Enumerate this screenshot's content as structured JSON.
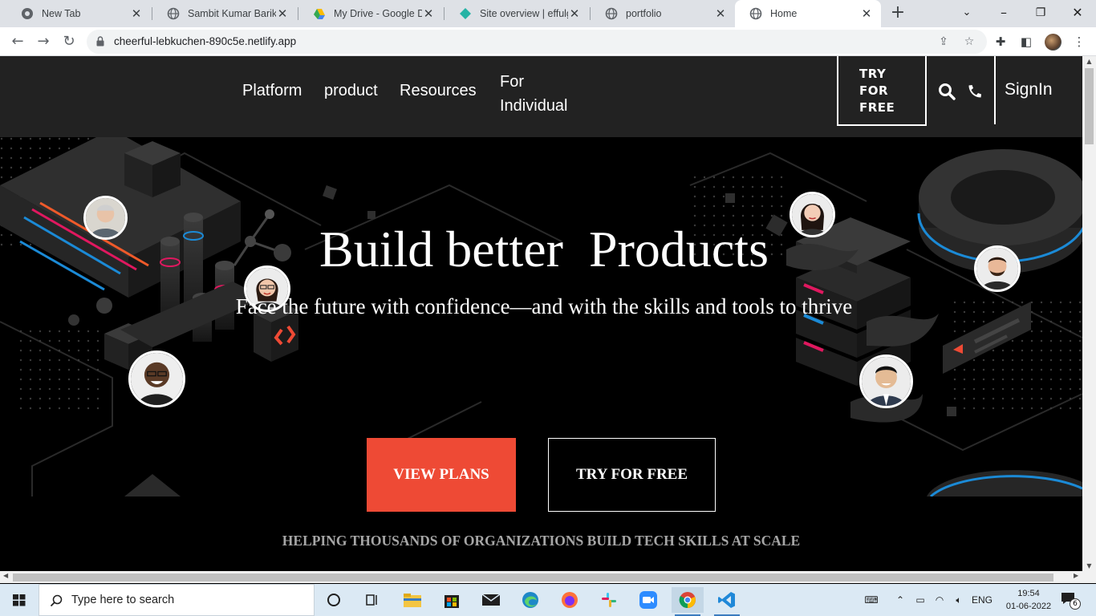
{
  "browser": {
    "tabs": [
      {
        "title": "New Tab",
        "icon": "chrome-icon"
      },
      {
        "title": "Sambit Kumar Barik | F",
        "icon": "globe-icon"
      },
      {
        "title": "My Drive - Google Dri",
        "icon": "google-drive-icon"
      },
      {
        "title": "Site overview | effulge",
        "icon": "netlify-icon"
      },
      {
        "title": "portfolio",
        "icon": "globe-icon"
      },
      {
        "title": "Home",
        "icon": "globe-icon",
        "active": true
      }
    ],
    "url": "cheerful-lebkuchen-890c5e.netlify.app"
  },
  "site": {
    "nav": {
      "platform": "Platform",
      "product": "product",
      "resources": "Resources",
      "for_line1": "For",
      "for_line2": "Individual",
      "try_line1": "TRY",
      "try_line2": "FOR",
      "try_line3": "FREE",
      "signin": "SignIn"
    },
    "hero": {
      "headline": "Build better  Products",
      "subline": "Face the future with confidence—and with the skills and tools to thrive",
      "view_plans": "VIEW PLANS",
      "try_free": "TRY FOR FREE"
    },
    "helping": "HELPING THOUSANDS OF ORGANIZATIONS BUILD TECH SKILLS AT SCALE",
    "accent_color": "#ee4a35"
  },
  "taskbar": {
    "search_placeholder": "Type here to search",
    "language": "ENG",
    "time": "19:54",
    "date": "01-06-2022",
    "notification_count": "6"
  }
}
